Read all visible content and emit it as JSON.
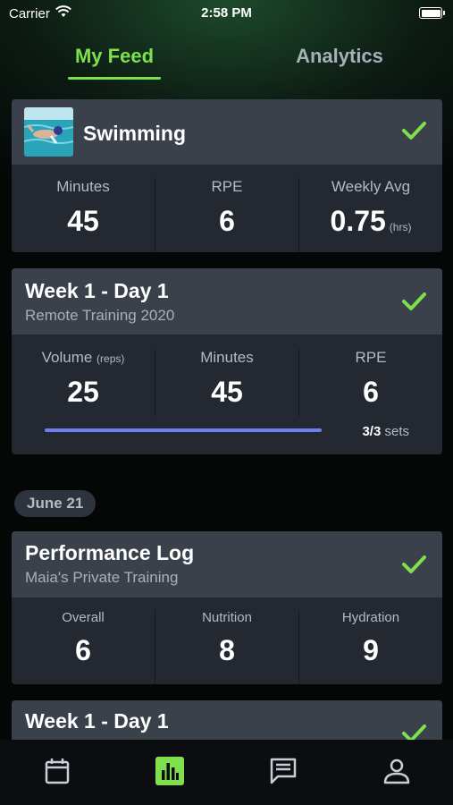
{
  "status_bar": {
    "carrier": "Carrier",
    "time": "2:58 PM"
  },
  "tabs": {
    "feed": "My Feed",
    "analytics": "Analytics"
  },
  "cards": {
    "swimming": {
      "title": "Swimming",
      "stats": [
        {
          "label": "Minutes",
          "value": "45"
        },
        {
          "label": "RPE",
          "value": "6"
        },
        {
          "label": "Weekly Avg",
          "value": "0.75",
          "unit": "(hrs)"
        }
      ]
    },
    "week1": {
      "title": "Week 1 - Day 1",
      "subtitle": "Remote Training 2020",
      "stats": [
        {
          "label": "Volume",
          "label_small": "(reps)",
          "value": "25"
        },
        {
          "label": "Minutes",
          "value": "45"
        },
        {
          "label": "RPE",
          "value": "6"
        }
      ],
      "progress": {
        "fraction": 1.0,
        "count": "3/3",
        "unit": "sets"
      }
    },
    "date_chip": "June 21",
    "performance": {
      "title": "Performance Log",
      "subtitle": "Maia's Private Training",
      "stats": [
        {
          "label": "Overall",
          "value": "6"
        },
        {
          "label": "Nutrition",
          "value": "8"
        },
        {
          "label": "Hydration",
          "value": "9"
        }
      ]
    },
    "week1_second": {
      "title": "Week 1 - Day 1"
    }
  },
  "colors": {
    "accent": "#7ee04c",
    "progress": "#6f7ff2",
    "card_header": "#3a414b",
    "card_body": "#232831"
  },
  "bottom_nav": [
    "calendar-icon",
    "stats-icon",
    "messages-icon",
    "profile-icon"
  ]
}
